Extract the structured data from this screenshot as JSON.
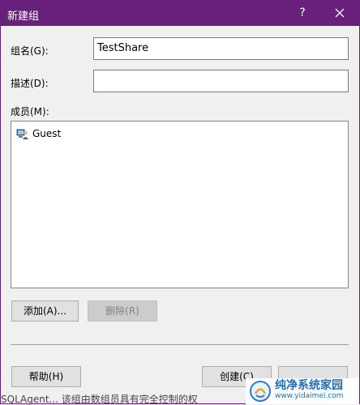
{
  "window": {
    "title": "新建组",
    "help_glyph": "?"
  },
  "form": {
    "group_name_label": "组名(G):",
    "group_name_value": "TestShare",
    "description_label": "描述(D):",
    "description_value": "",
    "members_label": "成员(M):"
  },
  "members": [
    {
      "name": "Guest",
      "icon": "user-icon"
    }
  ],
  "buttons": {
    "add": "添加(A)...",
    "remove": "删除(R)",
    "help": "帮助(H)",
    "create": "创建(C)"
  },
  "background_text": "SQLAgent... 该组由数组员具有完全控制的权",
  "watermark": {
    "main": "纯净系统家园",
    "url": "www.yidaimei.com"
  }
}
